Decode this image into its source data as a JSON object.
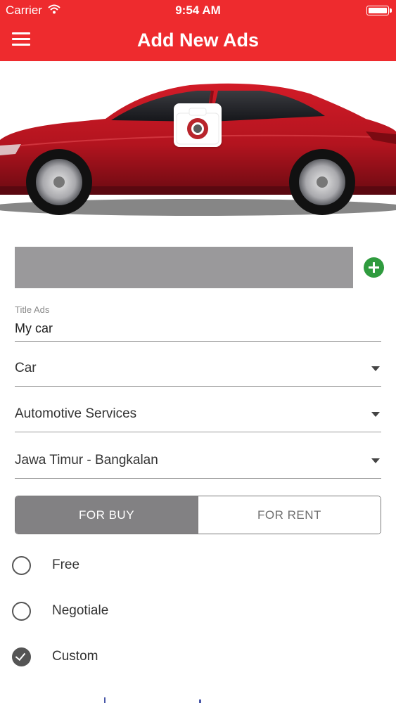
{
  "status_bar": {
    "carrier": "Carrier",
    "time": "9:54 AM"
  },
  "nav": {
    "title": "Add New Ads",
    "menu_icon": "hamburger-menu-icon"
  },
  "hero": {
    "image": "red-sedan-car",
    "camera_icon": "camera-icon"
  },
  "photo_row": {
    "add_icon": "add-circle-icon"
  },
  "form": {
    "title_label": "Title Ads",
    "title_value": "My car",
    "category": "Car",
    "sub_category": "Automotive Services",
    "location": "Jawa Timur -  Bangkalan"
  },
  "segment": {
    "buy": "FOR BUY",
    "rent": "FOR RENT",
    "selected": "FOR BUY"
  },
  "price_options": [
    {
      "label": "Free",
      "checked": false
    },
    {
      "label": "Negotiale",
      "checked": false
    },
    {
      "label": "Custom",
      "checked": true
    }
  ],
  "colors": {
    "primary": "#ee2b2e",
    "segment_active": "#828183",
    "add_button": "#2f9b3e",
    "car": "#b3141f"
  }
}
